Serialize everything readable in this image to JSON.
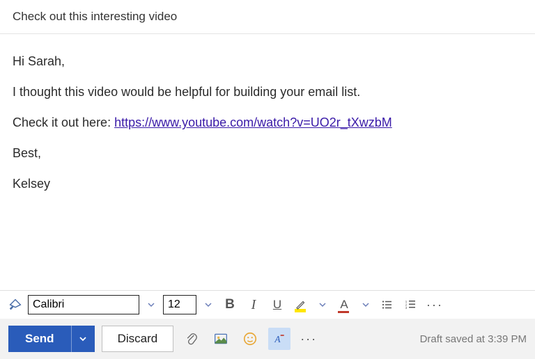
{
  "subject": "Check out this interesting video",
  "body": {
    "greeting": "Hi Sarah,",
    "line1": "I thought this video would be helpful for building your email list.",
    "link_prefix": "Check it out here: ",
    "link_text": "https://www.youtube.com/watch?v=UO2r_tXwzbM",
    "signoff": "Best,",
    "name": "Kelsey"
  },
  "format": {
    "font_name": "Calibri",
    "font_size": "12",
    "bold_label": "B",
    "italic_label": "I",
    "underline_label": "U",
    "font_color_letter": "A",
    "highlight_color": "#ffe600",
    "font_color": "#c0392b"
  },
  "actions": {
    "send_label": "Send",
    "discard_label": "Discard"
  },
  "status": {
    "draft_text": "Draft saved at 3:39 PM"
  }
}
